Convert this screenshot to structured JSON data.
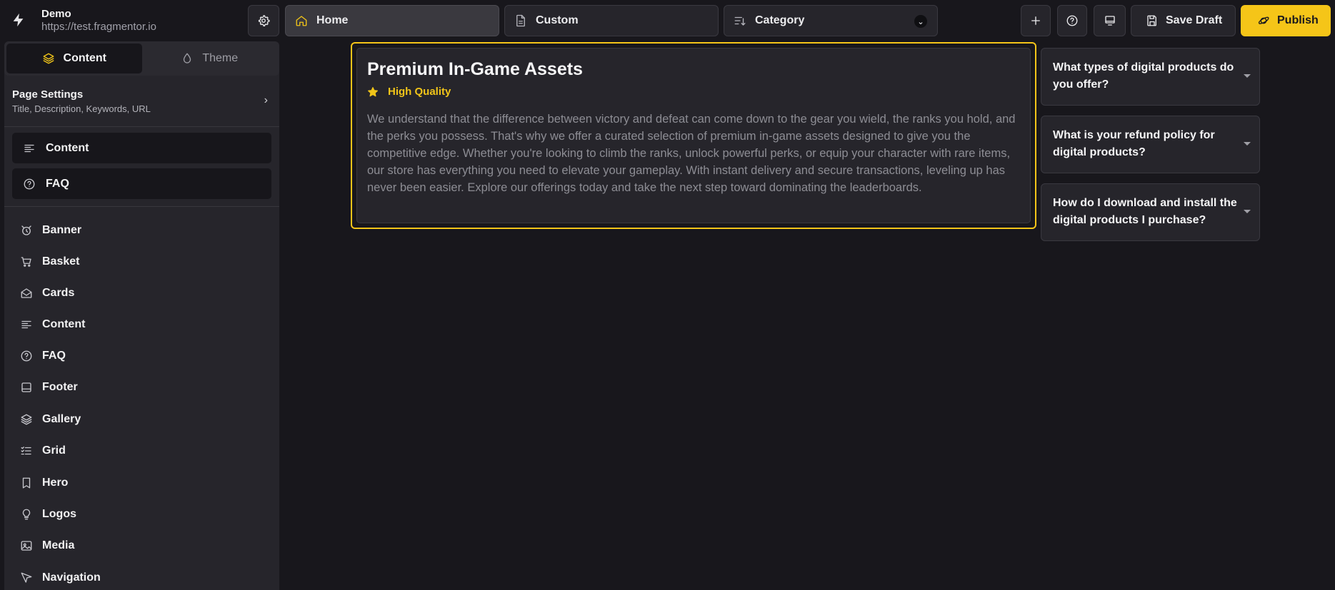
{
  "app": {
    "name": "Demo",
    "url": "https://test.fragmentor.io"
  },
  "toolbar": {
    "settings_icon": "gear-icon",
    "tabs": [
      {
        "label": "Home",
        "icon": "home-icon"
      },
      {
        "label": "Custom",
        "icon": "file-icon"
      },
      {
        "label": "Category",
        "icon": "sort-icon"
      }
    ],
    "save_label": "Save Draft",
    "publish_label": "Publish",
    "accent_color": "#f5c518"
  },
  "sidebar": {
    "tabs": [
      {
        "label": "Content",
        "icon": "layers-icon",
        "active": true
      },
      {
        "label": "Theme",
        "icon": "droplet-icon",
        "active": false
      }
    ],
    "page_settings": {
      "title": "Page Settings",
      "subtitle": "Title, Description, Keywords, URL"
    },
    "sections": [
      {
        "label": "Content",
        "icon": "align-left-icon"
      },
      {
        "label": "FAQ",
        "icon": "help-circle-icon"
      }
    ],
    "components": [
      {
        "label": "Banner",
        "icon": "alarm-icon"
      },
      {
        "label": "Basket",
        "icon": "cart-icon"
      },
      {
        "label": "Cards",
        "icon": "envelope-open-icon"
      },
      {
        "label": "Content",
        "icon": "align-left-icon"
      },
      {
        "label": "FAQ",
        "icon": "help-circle-icon"
      },
      {
        "label": "Footer",
        "icon": "footer-icon"
      },
      {
        "label": "Gallery",
        "icon": "layers-icon"
      },
      {
        "label": "Grid",
        "icon": "checklist-icon"
      },
      {
        "label": "Hero",
        "icon": "bookmark-icon"
      },
      {
        "label": "Logos",
        "icon": "lightbulb-icon"
      },
      {
        "label": "Media",
        "icon": "image-icon"
      },
      {
        "label": "Navigation",
        "icon": "navigation-icon"
      }
    ]
  },
  "content_block": {
    "title": "Premium In-Game Assets",
    "badge": "High Quality",
    "body": "We understand that the difference between victory and defeat can come down to the gear you wield, the ranks you hold, and the perks you possess. That's why we offer a curated selection of premium in-game assets designed to give you the competitive edge. Whether you're looking to climb the ranks, unlock powerful perks, or equip your character with rare items, our store has everything you need to elevate your gameplay. With instant delivery and secure transactions, leveling up has never been easier. Explore our offerings today and take the next step toward dominating the leaderboards."
  },
  "faq": [
    {
      "question": "What types of digital products do you offer?"
    },
    {
      "question": "What is your refund policy for digital products?"
    },
    {
      "question": "How do I download and install the digital products I purchase?"
    }
  ]
}
